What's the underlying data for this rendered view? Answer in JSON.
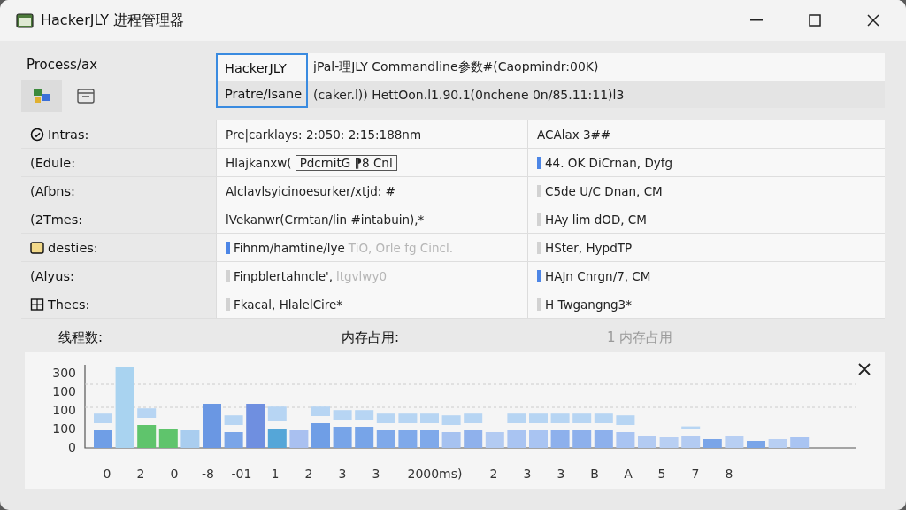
{
  "window": {
    "title": "HackerJLY 进程管理器"
  },
  "header": {
    "label": "Process/ax",
    "rows": [
      {
        "highlight": "HackerJLY",
        "text": "jPal-理JLY Commandline参数#(Caopmindr:00K)"
      },
      {
        "highlight": "Pratre/lsane",
        "text": "(caker.l)) HettOon.l1.90.1(0nchene 0n/85.11:11)l3"
      }
    ]
  },
  "table": {
    "rows": [
      {
        "kind": "check",
        "label": "Intras:",
        "value": {
          "kind": "bare",
          "parts": [
            {
              "kind": "plain",
              "text": "Pre|carklays: 2:050: 2:15:188nm"
            }
          ]
        },
        "detail": {
          "kind": "bare",
          "text": "ACAlax 3##"
        }
      },
      {
        "kind": "plain",
        "label": "(Edule:",
        "value": {
          "kind": "bare",
          "parts": [
            {
              "kind": "plain",
              "text": "Hlajkanxw("
            },
            {
              "kind": "boxed",
              "text": "PdcrnitG ⁋8 Cnl"
            }
          ]
        },
        "detail": {
          "kind": "accent",
          "text": "44. OK DiCrnan, Dyfg"
        }
      },
      {
        "kind": "plain",
        "label": "(Afbns:",
        "value": {
          "kind": "bare",
          "parts": [
            {
              "kind": "plain",
              "text": "Alclavlsyicinoesurker/xtjd: #"
            }
          ]
        },
        "detail": {
          "kind": "muted",
          "text": "C5de U/C Dnan, CM"
        }
      },
      {
        "kind": "plain",
        "label": "(2Tmes:",
        "value": {
          "kind": "bare",
          "parts": [
            {
              "kind": "plain",
              "text": "lVekanwr(Crmtan/lin #intabuin),*"
            }
          ]
        },
        "detail": {
          "kind": "muted",
          "text": "HAy lim dOD, CM"
        }
      },
      {
        "kind": "tag",
        "label": "desties:",
        "value": {
          "kind": "accent",
          "parts": [
            {
              "kind": "plain",
              "text": "Fihnm/hamtine/lye"
            },
            {
              "kind": "faded",
              "text": "TiO, Orle fg Cincl."
            }
          ]
        },
        "detail": {
          "kind": "muted",
          "text": "HSter, HypdTP"
        }
      },
      {
        "kind": "plain",
        "label": "(Alyus:",
        "value": {
          "kind": "muted",
          "parts": [
            {
              "kind": "plain",
              "text": "Finpblertahncle',"
            },
            {
              "kind": "faded",
              "text": "ltgvlwy0"
            }
          ]
        },
        "detail": {
          "kind": "accent",
          "text": "HAJn Cnrgn/7, CM"
        }
      },
      {
        "kind": "grid",
        "label": "Thecs:",
        "value": {
          "kind": "muted",
          "parts": [
            {
              "kind": "plain",
              "text": "Fkacal, HlalelCire*"
            }
          ]
        },
        "detail": {
          "kind": "muted",
          "text": "H Twgangng3*"
        }
      }
    ]
  },
  "stats": [
    {
      "kind": "plain",
      "text": "线程数:"
    },
    {
      "kind": "plain",
      "text": "内存占用:"
    },
    {
      "kind": "faded",
      "text": "1 内存占用"
    }
  ],
  "chart": {
    "y_labels": [
      "300",
      "100",
      "100",
      "100",
      "0"
    ],
    "x_labels": [
      "0",
      "2",
      "0",
      "-8",
      "-01",
      "1",
      "2",
      "3",
      "3",
      "2000ms)",
      "2",
      "3",
      "3",
      "B",
      "A",
      "5",
      "7",
      "8"
    ]
  }
}
